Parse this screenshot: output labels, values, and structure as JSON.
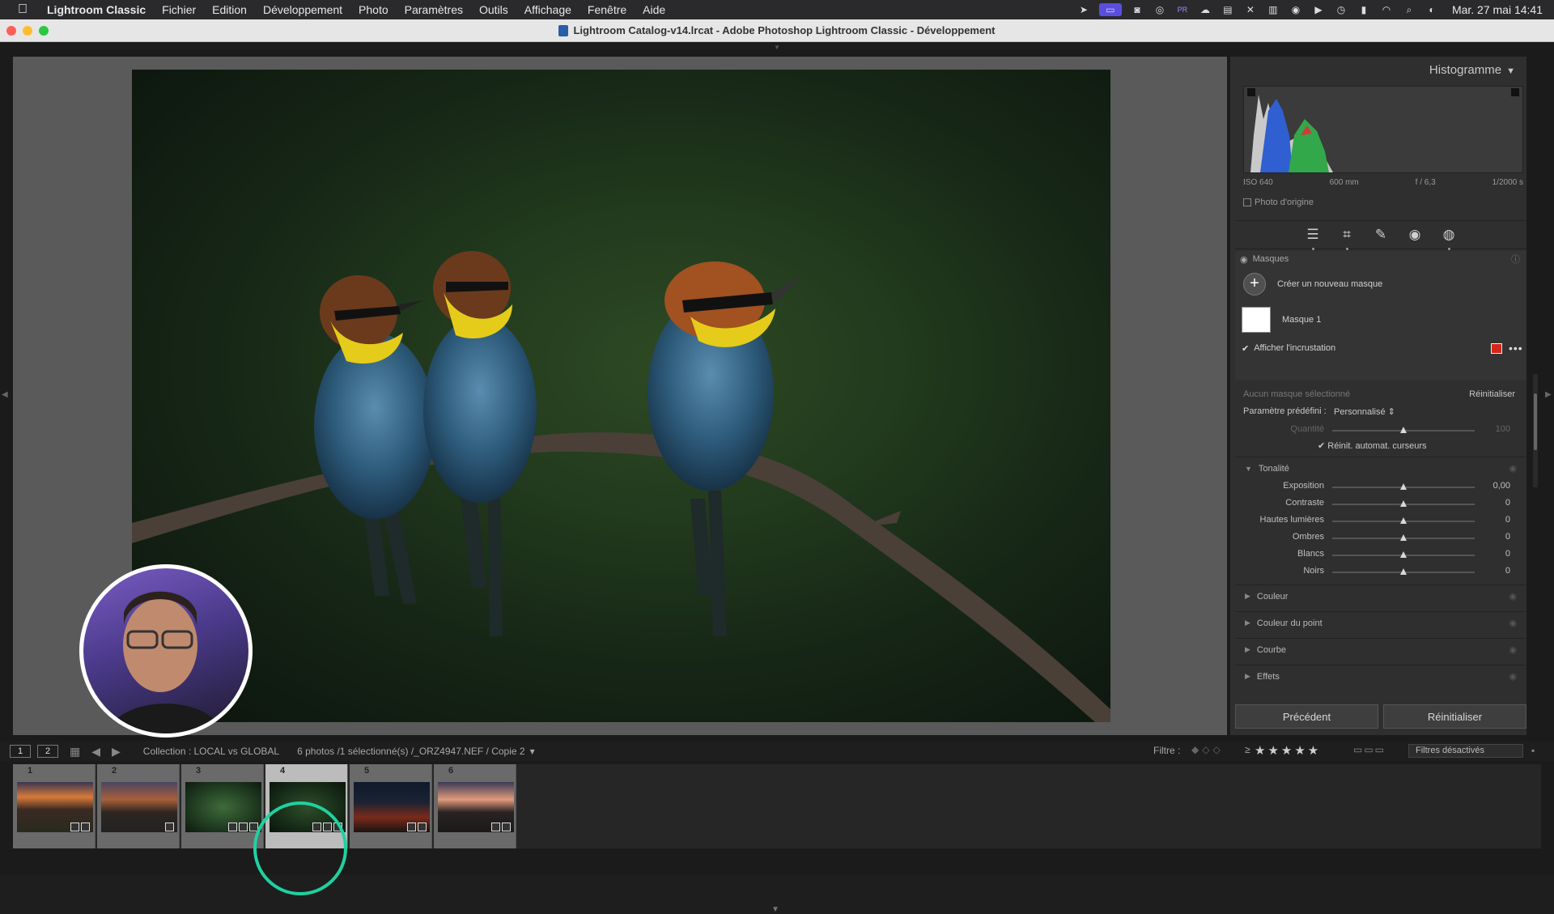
{
  "menubar": {
    "app_name": "Lightroom Classic",
    "items": [
      "Fichier",
      "Edition",
      "Développement",
      "Photo",
      "Paramètres",
      "Outils",
      "Affichage",
      "Fenêtre",
      "Aide"
    ],
    "clock": "Mar. 27 mai 14:41",
    "status_icons": [
      "cursor-icon",
      "screen-record-icon",
      "camera-icon",
      "logo-icon",
      "premiere-icon",
      "creative-cloud-icon",
      "clipboard-icon",
      "grid-icon",
      "layout-icon",
      "user-icon",
      "play-icon",
      "time-icon",
      "battery-icon",
      "wifi-icon",
      "search-icon",
      "control-center-icon"
    ],
    "pr_label": "PR"
  },
  "window": {
    "title": "Lightroom Catalog-v14.lrcat - Adobe Photoshop Lightroom Classic - Développement",
    "traffic_colors": [
      "#ff5f57",
      "#febc2e",
      "#28c840"
    ]
  },
  "right_panel": {
    "histogram_title": "Histogramme",
    "exif": {
      "iso": "ISO 640",
      "focal": "600 mm",
      "aperture": "f / 6,3",
      "shutter": "1/2000 s"
    },
    "original_photo_label": "Photo d'origine",
    "masks_label": "Masques",
    "create_mask_label": "Créer un nouveau masque",
    "mask_name": "Masque 1",
    "overlay_label": "Afficher l'incrustation",
    "overlay_color": "#d7261a",
    "no_mask_selected": "Aucun masque sélectionné",
    "reset_label": "Réinitialiser",
    "preset_label": "Paramètre prédéfini :",
    "preset_value": "Personnalisé",
    "amount_label": "Quantité",
    "amount_value": "100",
    "auto_reset_label": "Réinit. automat. curseurs",
    "tonality_label": "Tonalité",
    "sliders": [
      {
        "label": "Exposition",
        "value": "0,00"
      },
      {
        "label": "Contraste",
        "value": "0"
      },
      {
        "label": "Hautes lumières",
        "value": "0"
      },
      {
        "label": "Ombres",
        "value": "0"
      },
      {
        "label": "Blancs",
        "value": "0"
      },
      {
        "label": "Noirs",
        "value": "0"
      }
    ],
    "sections": [
      "Couleur",
      "Couleur du point",
      "Courbe",
      "Effets"
    ],
    "previous_button": "Précédent",
    "reset_button": "Réinitialiser"
  },
  "filmstrip_header": {
    "view1": "1",
    "view2": "2",
    "collection": "Collection : LOCAL vs GLOBAL",
    "count": "6 photos /1 sélectionné(s) /_ORZ4947.NEF / Copie 2",
    "filter_label": "Filtre :",
    "filter_gte": "≥",
    "stars": "★★★★★",
    "filter_select": "Filtres désactivés"
  },
  "filmstrip": {
    "thumbnails": [
      {
        "number": "1",
        "selected": false,
        "scene": "sunset"
      },
      {
        "number": "2",
        "selected": false,
        "scene": "sunset-dim"
      },
      {
        "number": "3",
        "selected": false,
        "scene": "birds"
      },
      {
        "number": "4",
        "selected": true,
        "scene": "birds"
      },
      {
        "number": "5",
        "selected": false,
        "scene": "night"
      },
      {
        "number": "6",
        "selected": false,
        "scene": "sunset"
      }
    ]
  }
}
